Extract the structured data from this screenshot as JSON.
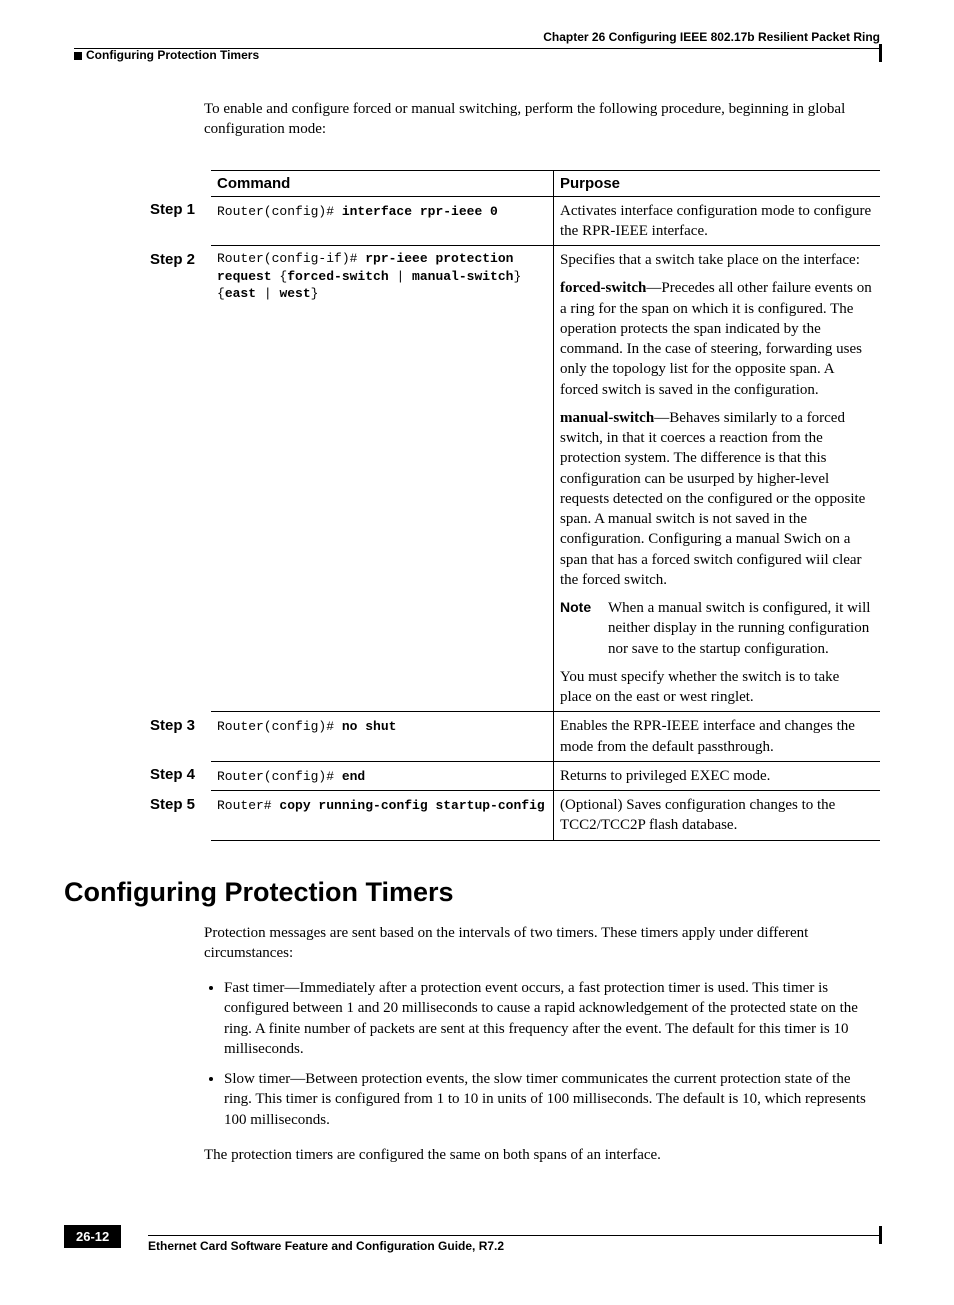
{
  "header": {
    "chapter": "Chapter 26 Configuring IEEE 802.17b Resilient Packet Ring",
    "section": "Configuring Protection Timers"
  },
  "intro": "To enable and configure forced or manual switching, perform the following procedure, beginning in global configuration mode:",
  "table": {
    "head": {
      "command": "Command",
      "purpose": "Purpose"
    },
    "rows": [
      {
        "step": "Step 1",
        "cmd_prefix": "Router(config)# ",
        "cmd_bold": "interface rpr-ieee 0",
        "purpose_plain": "Activates interface configuration mode to configure the RPR-IEEE interface."
      },
      {
        "step": "Step 2",
        "cmd_line1_prefix": "Router(config-if)# ",
        "cmd_line1_bold": "rpr-ieee protection",
        "cmd_line2_bold1": "request",
        "cmd_line2_plain1": " {",
        "cmd_line2_bold2": "forced-switch",
        "cmd_line2_plain2": " | ",
        "cmd_line2_bold3": "manual-switch",
        "cmd_line2_plain3": "}",
        "cmd_line3_plain1": "{",
        "cmd_line3_bold1": "east",
        "cmd_line3_plain2": " | ",
        "cmd_line3_bold2": "west",
        "cmd_line3_plain3": "}",
        "p1": "Specifies that a switch take place on the interface:",
        "p2_bold": "forced-switch",
        "p2_rest": "—Precedes all other failure events on a ring for the span on which it is configured. The operation protects the span indicated by the command. In the case of steering, forwarding uses only the topology list for the opposite span. A forced switch is saved in the configuration.",
        "p3_bold": "manual-switch",
        "p3_rest": "—Behaves similarly to a forced switch, in that it coerces a reaction from the protection system. The difference is that this configuration can be usurped by higher-level requests detected on the configured or the opposite span. A manual switch is not saved in the configuration. Configuring a manual Swich on a span that has a forced switch configured wiil clear the forced switch.",
        "note_label": "Note",
        "note_text": "When a manual switch is configured, it will neither display in the running configuration nor save to the startup configuration.",
        "p4": "You must specify whether the switch is to take place on the east or west ringlet."
      },
      {
        "step": "Step 3",
        "cmd_prefix": "Router(config)# ",
        "cmd_bold": "no shut",
        "purpose_plain": "Enables the RPR-IEEE interface and changes the mode from the default passthrough."
      },
      {
        "step": "Step 4",
        "cmd_prefix": "Router(config)# ",
        "cmd_bold": "end",
        "purpose_plain": "Returns to privileged EXEC mode."
      },
      {
        "step": "Step 5",
        "cmd_prefix": "Router# ",
        "cmd_bold": "copy running-config startup-config",
        "purpose_plain": "(Optional) Saves configuration changes to the TCC2/TCC2P flash database."
      }
    ]
  },
  "section2": {
    "title": "Configuring Protection Timers",
    "intro": "Protection messages are sent based on the intervals of two timers. These timers apply under different circumstances:",
    "bullets": [
      "Fast timer—Immediately after a protection event occurs, a fast protection timer is used. This timer is configured between 1 and 20 milliseconds to cause a rapid acknowledgement of the protected state on the ring. A finite number of packets are sent at this frequency after the event. The default for this timer is 10 milliseconds.",
      "Slow timer—Between protection events, the slow timer communicates the current protection state of the ring. This timer is configured from 1 to 10 in units of 100 milliseconds. The default is 10, which represents 100 milliseconds."
    ],
    "outro": "The protection timers are configured the same on both spans of an interface."
  },
  "footer": {
    "guide": "Ethernet Card Software Feature and Configuration Guide, R7.2",
    "page": "26-12"
  }
}
